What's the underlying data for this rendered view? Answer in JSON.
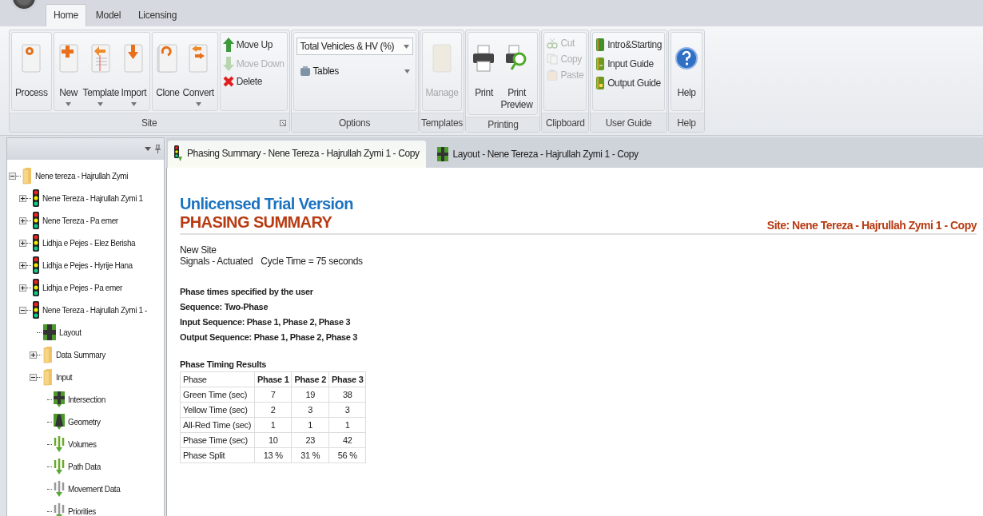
{
  "app_tabs": [
    {
      "label": "Home",
      "selected": true
    },
    {
      "label": "Model",
      "selected": false
    },
    {
      "label": "Licensing",
      "selected": false
    }
  ],
  "ribbon_groups": [
    {
      "label": "Site",
      "launcher": true,
      "sections": [
        {
          "kind": "large",
          "items": [
            {
              "label": "Process",
              "disabled": false,
              "menu": false
            }
          ]
        },
        {
          "kind": "large",
          "items": [
            {
              "label": "New",
              "disabled": false,
              "menu": true
            },
            {
              "label": "Template",
              "disabled": false,
              "menu": true
            },
            {
              "label": "Import",
              "disabled": false,
              "menu": true
            }
          ]
        },
        {
          "kind": "large",
          "items": [
            {
              "label": "Clone",
              "disabled": false,
              "menu": false
            },
            {
              "label": "Convert",
              "disabled": false,
              "menu": true
            }
          ]
        },
        {
          "kind": "small",
          "items": [
            {
              "label": "Move Up",
              "disabled": false
            },
            {
              "label": "Move Down",
              "disabled": true
            },
            {
              "label": "Delete",
              "disabled": false
            }
          ]
        }
      ]
    },
    {
      "label": "Options",
      "launcher": false,
      "sections": [
        {
          "kind": "combo",
          "items": [
            {
              "label": "Total Vehicles & HV (%)",
              "disabled": false
            },
            {
              "label": "Tables",
              "disabled": false
            }
          ]
        }
      ]
    },
    {
      "label": "Templates",
      "launcher": false,
      "sections": [
        {
          "kind": "large",
          "items": [
            {
              "label": "Manage",
              "disabled": true,
              "menu": false
            }
          ]
        }
      ]
    },
    {
      "label": "Printing",
      "launcher": false,
      "sections": [
        {
          "kind": "large",
          "items": [
            {
              "label": "Print",
              "disabled": false,
              "menu": false
            },
            {
              "label": "Print Preview",
              "disabled": false,
              "menu": false
            }
          ]
        }
      ]
    },
    {
      "label": "Clipboard",
      "launcher": false,
      "sections": [
        {
          "kind": "small",
          "items": [
            {
              "label": "Cut",
              "disabled": true
            },
            {
              "label": "Copy",
              "disabled": true
            },
            {
              "label": "Paste",
              "disabled": true
            }
          ]
        }
      ]
    },
    {
      "label": "User Guide",
      "launcher": false,
      "sections": [
        {
          "kind": "small",
          "items": [
            {
              "label": "Intro&Starting",
              "disabled": false
            },
            {
              "label": "Input Guide",
              "disabled": false
            },
            {
              "label": "Output Guide",
              "disabled": false
            }
          ]
        }
      ]
    },
    {
      "label": "Help",
      "launcher": false,
      "sections": [
        {
          "kind": "large",
          "items": [
            {
              "label": "Help",
              "disabled": false,
              "menu": false
            }
          ]
        }
      ]
    }
  ],
  "tree": [
    {
      "label": "Nene tereza - Hajrullah Zymi",
      "kind": "folder",
      "expanded": true,
      "children": [
        {
          "label": "Nene Tereza - Hajrullah Zymi 1",
          "kind": "site",
          "expanded": false
        },
        {
          "label": "Nene Tereza - Pa emer",
          "kind": "site",
          "expanded": false
        },
        {
          "label": "Lidhja e Pejes - Elez Berisha",
          "kind": "site",
          "expanded": false
        },
        {
          "label": "Lidhja e Pejes - Hyrije Hana",
          "kind": "site",
          "expanded": false
        },
        {
          "label": "Lidhja e Pejes - Pa emer",
          "kind": "site",
          "expanded": false
        },
        {
          "label": "Nene Tereza - Hajrullah Zymi 1 -",
          "kind": "site",
          "expanded": true,
          "children": [
            {
              "label": "Layout",
              "kind": "layout"
            },
            {
              "label": "Data Summary",
              "kind": "folder",
              "expanded": false
            },
            {
              "label": "Input",
              "kind": "folder",
              "expanded": true,
              "children": [
                {
                  "label": "Intersection",
                  "kind": "intersection"
                },
                {
                  "label": "Geometry",
                  "kind": "geometry"
                },
                {
                  "label": "Volumes",
                  "kind": "flow"
                },
                {
                  "label": "Path Data",
                  "kind": "flow"
                },
                {
                  "label": "Movement Data",
                  "kind": "flow_inactive"
                },
                {
                  "label": "Priorities",
                  "kind": "flow_inactive"
                }
              ]
            }
          ]
        }
      ]
    }
  ],
  "doc_tabs": [
    {
      "label": "Phasing Summary - Nene Tereza - Hajrullah Zymi 1 - Copy",
      "selected": true
    },
    {
      "label": "Layout - Nene Tereza - Hajrullah Zymi 1 - Copy",
      "selected": false
    }
  ],
  "report": {
    "watermark": "Unlicensed Trial Version",
    "title": "PHASING SUMMARY",
    "site": "Site: Nene Tereza - Hajrullah Zymi 1 - Copy",
    "site_name": "New Site",
    "signals": "Signals - Actuated",
    "cycle_time": "Cycle Time = 75 seconds",
    "notes": [
      "Phase times specified by the user",
      "Sequence: Two-Phase",
      "Input Sequence: Phase 1, Phase 2, Phase 3",
      "Output Sequence: Phase 1, Phase 2, Phase 3"
    ],
    "table": {
      "title": "Phase Timing Results",
      "columns": [
        "Phase",
        "Phase 1",
        "Phase 2",
        "Phase 3"
      ],
      "rows": [
        [
          "Green Time (sec)",
          "7",
          "19",
          "38"
        ],
        [
          "Yellow Time (sec)",
          "2",
          "3",
          "3"
        ],
        [
          "All-Red Time (sec)",
          "1",
          "1",
          "1"
        ],
        [
          "Phase Time (sec)",
          "10",
          "23",
          "42"
        ],
        [
          "Phase Split",
          "13 %",
          "31 %",
          "56 %"
        ]
      ]
    }
  }
}
